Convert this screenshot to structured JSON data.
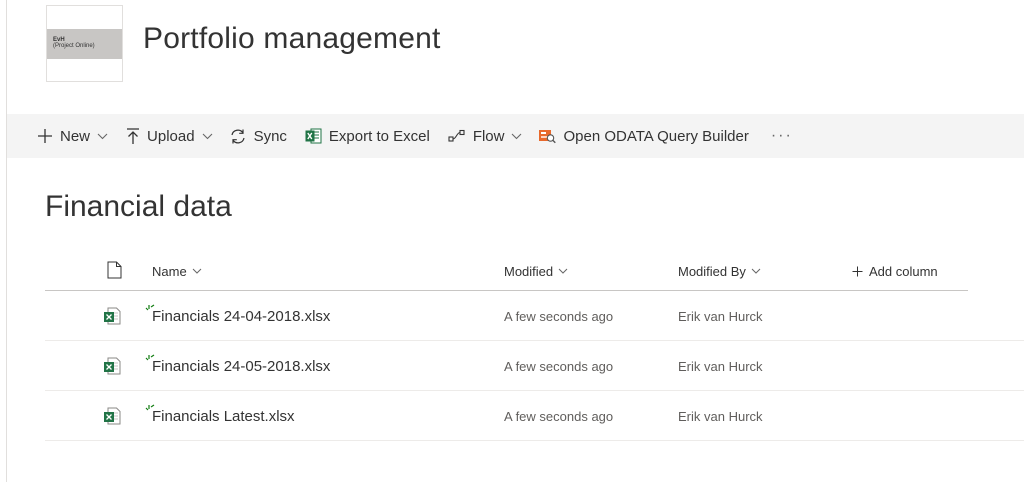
{
  "site": {
    "logo_line1": "EvH",
    "logo_line2": "(Project Online)",
    "title": "Portfolio management"
  },
  "command_bar": {
    "new_label": "New",
    "upload_label": "Upload",
    "sync_label": "Sync",
    "export_label": "Export to Excel",
    "flow_label": "Flow",
    "odata_label": "Open ODATA Query Builder",
    "more_label": "···"
  },
  "library": {
    "title": "Financial data",
    "columns": {
      "name": "Name",
      "modified": "Modified",
      "modified_by": "Modified By",
      "add_column": "Add column"
    },
    "rows": [
      {
        "name": "Financials 24-04-2018.xlsx",
        "modified": "A few seconds ago",
        "modified_by": "Erik van Hurck"
      },
      {
        "name": "Financials 24-05-2018.xlsx",
        "modified": "A few seconds ago",
        "modified_by": "Erik van Hurck"
      },
      {
        "name": "Financials Latest.xlsx",
        "modified": "A few seconds ago",
        "modified_by": "Erik van Hurck"
      }
    ]
  },
  "colors": {
    "excel_green": "#217346",
    "odata_orange": "#e8692c",
    "new_marker_green": "#107c10",
    "command_bar_bg": "#f4f4f4"
  }
}
